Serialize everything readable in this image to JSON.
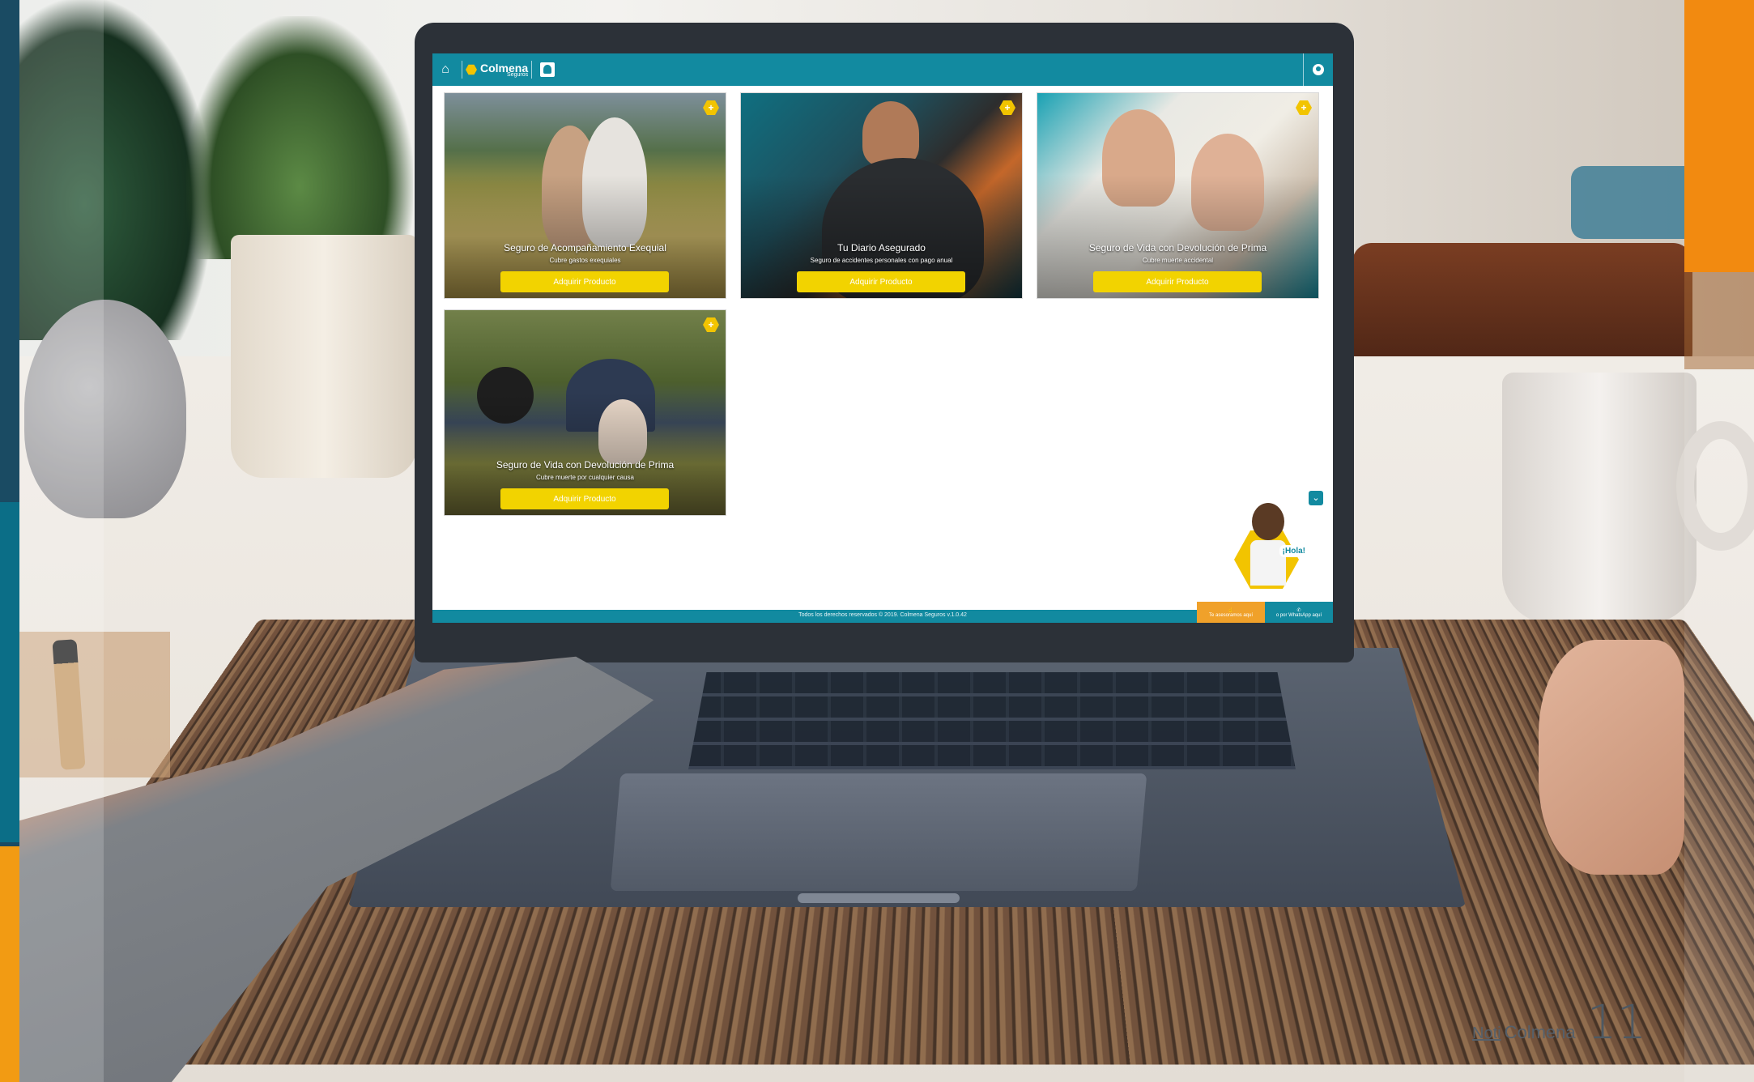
{
  "topbar": {
    "home_icon": "home-icon",
    "logo_text": "Colmena",
    "logo_sub": "Seguros",
    "profile_icon": "id-card-icon",
    "user_icon": "user-circle-icon",
    "color": "#128aa0"
  },
  "cards": [
    {
      "title": "Seguro de Acompañamiento Exequial",
      "subtitle": "Cubre gastos exequiales",
      "button": "Adquirir Producto",
      "badge": "+"
    },
    {
      "title": "Tu Diario Asegurado",
      "subtitle": "Seguro de accidentes personales con pago anual",
      "button": "Adquirir Producto",
      "badge": "+"
    },
    {
      "title": "Seguro de Vida con Devolución de Prima",
      "subtitle": "Cubre muerte accidental",
      "button": "Adquirir Producto",
      "badge": "+"
    },
    {
      "title": "Seguro de Vida con Devolución de Prima",
      "subtitle": "Cubre muerte por cualquier causa",
      "button": "Adquirir Producto",
      "badge": "+"
    }
  ],
  "assistant": {
    "greeting": "¡Hola!",
    "chevron": "chevron-down-icon"
  },
  "footer": {
    "copyright": "Todos los derechos reservados © 2019. Colmena Seguros v.1.0.42",
    "btn_advisor": "Te asesoramos aquí",
    "btn_whatsapp": "o por WhatsApp aquí"
  },
  "magazine": {
    "brand_prefix": "Noti",
    "brand_name": "Colmena",
    "page_number": "11"
  },
  "colors": {
    "accent_yellow": "#f2d300",
    "brand_teal": "#128aa0",
    "magazine_orange": "#f28a10"
  }
}
